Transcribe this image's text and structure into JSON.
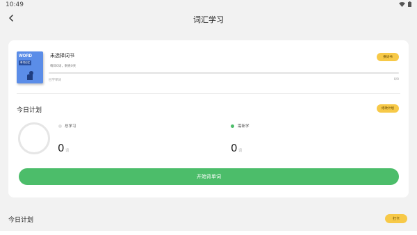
{
  "status_bar": {
    "time": "10:49"
  },
  "header": {
    "title": "词汇学习"
  },
  "book": {
    "cover_word": "WORD",
    "cover_sub": "单词记忆",
    "title": "未选择词书",
    "meta": "每日0词，剩余0天",
    "change_label": "换词书",
    "progress_fraction": 0,
    "learned_label": "已学单词",
    "progress_count": "0/0"
  },
  "plan": {
    "title": "今日计划",
    "edit_label": "修改计划",
    "total_label": "总学习",
    "total_value": "0",
    "total_unit": "词",
    "new_label": "需新学",
    "new_value": "0",
    "new_unit": "词",
    "start_label": "开始背单词"
  },
  "bottom": {
    "title": "今日计划",
    "checkin_label": "打卡"
  },
  "colors": {
    "accent_green": "#4cbd6a",
    "accent_yellow": "#f7c948",
    "book_blue": "#5b8de8"
  }
}
